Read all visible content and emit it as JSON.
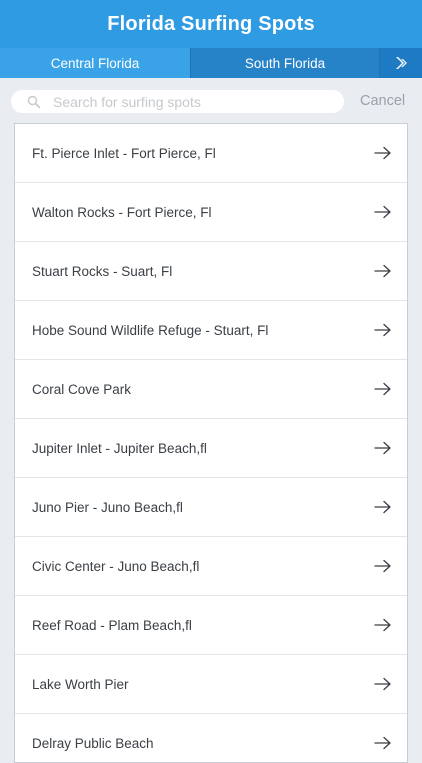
{
  "header": {
    "title": "Florida Surfing Spots"
  },
  "tabs": [
    {
      "label": "Central Florida",
      "selected": false
    },
    {
      "label": "South Florida",
      "selected": true
    }
  ],
  "next_tab_icon": "double-chevron-right-icon",
  "search": {
    "placeholder": "Search for surfing spots",
    "value": "",
    "cancel_label": "Cancel"
  },
  "spots": [
    {
      "label": "Ft. Pierce Inlet - Fort Pierce, Fl"
    },
    {
      "label": "Walton Rocks - Fort Pierce, Fl"
    },
    {
      "label": "Stuart Rocks - Suart, Fl"
    },
    {
      "label": "Hobe Sound Wildlife Refuge - Stuart, Fl"
    },
    {
      "label": "Coral Cove Park"
    },
    {
      "label": "Jupiter Inlet - Jupiter Beach,fl"
    },
    {
      "label": "Juno Pier - Juno Beach,fl"
    },
    {
      "label": "Civic Center - Juno Beach,fl"
    },
    {
      "label": "Reef Road - Plam Beach,fl"
    },
    {
      "label": "Lake Worth Pier"
    },
    {
      "label": "Delray Public Beach"
    }
  ],
  "colors": {
    "header": "#2f9be3",
    "tab_bar": "#3aa3e8",
    "tab_selected": "#2783c8",
    "next_tab": "#1e7ac2",
    "background": "#e9edf2"
  }
}
